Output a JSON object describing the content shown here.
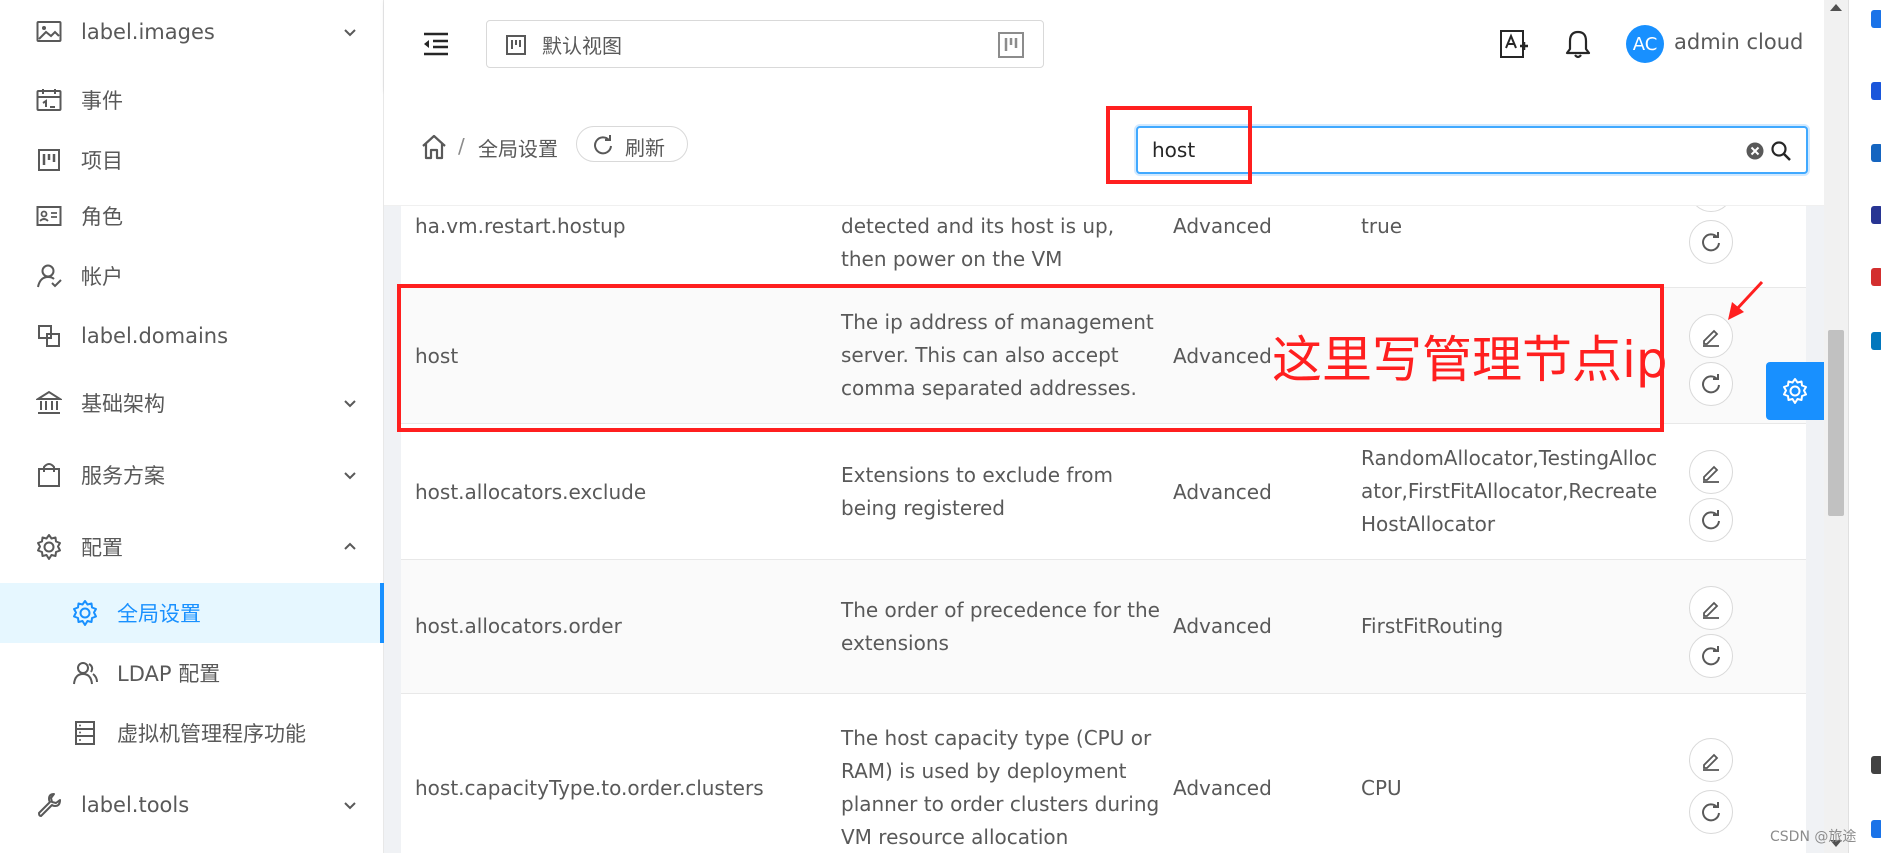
{
  "sidebar": {
    "items": [
      {
        "label": "label.images",
        "icon": "image-icon",
        "has_chevron": true,
        "chevron": "down"
      },
      {
        "label": "事件",
        "icon": "calendar-icon"
      },
      {
        "label": "项目",
        "icon": "project-icon"
      },
      {
        "label": "角色",
        "icon": "id-card-icon"
      },
      {
        "label": "帐户",
        "icon": "user-icon"
      },
      {
        "label": "label.domains",
        "icon": "block-icon"
      },
      {
        "label": "基础架构",
        "icon": "bank-icon",
        "has_chevron": true,
        "chevron": "down"
      },
      {
        "label": "服务方案",
        "icon": "shopping-icon",
        "has_chevron": true,
        "chevron": "down"
      },
      {
        "label": "配置",
        "icon": "setting-icon",
        "has_chevron": true,
        "chevron": "up"
      },
      {
        "label": "全局设置",
        "icon": "setting-icon",
        "sub": true,
        "active": true
      },
      {
        "label": "LDAP 配置",
        "icon": "team-icon",
        "sub": true
      },
      {
        "label": "虚拟机管理程序功能",
        "icon": "database-icon",
        "sub": true
      },
      {
        "label": "label.tools",
        "icon": "tool-icon",
        "has_chevron": true,
        "chevron": "down"
      }
    ]
  },
  "header": {
    "view_select_label": "默认视图",
    "user_initials": "AC",
    "user_name": "admin cloud"
  },
  "breadcrumb": {
    "separator": "/",
    "current": "全局设置",
    "refresh_label": "刷新"
  },
  "search": {
    "value": "host"
  },
  "table": {
    "rows": [
      {
        "name": "ha.vm.restart.hostup",
        "description": "detected and its host is up, then power on the VM",
        "category": "Advanced",
        "value": "true"
      },
      {
        "name": "host",
        "description": "The ip address of management server. This can also accept comma separated addresses.",
        "category": "Advanced",
        "value": ""
      },
      {
        "name": "host.allocators.exclude",
        "description": "Extensions to exclude from being registered",
        "category": "Advanced",
        "value": "RandomAllocator,TestingAllocator,FirstFitAllocator,RecreateHostAllocator"
      },
      {
        "name": "host.allocators.order",
        "description": "The order of precedence for the extensions",
        "category": "Advanced",
        "value": "FirstFitRouting"
      },
      {
        "name": "host.capacityType.to.order.clusters",
        "description": "The host capacity type (CPU or RAM) is used by deployment planner to order clusters during VM resource allocation",
        "category": "Advanced",
        "value": "CPU"
      }
    ]
  },
  "annotation": {
    "text": "这里写管理节点ip",
    "color": "#ff1f1f"
  },
  "watermark": "CSDN @旅途",
  "colors": {
    "primary": "#1890ff",
    "annotation": "#ff1f1f"
  }
}
